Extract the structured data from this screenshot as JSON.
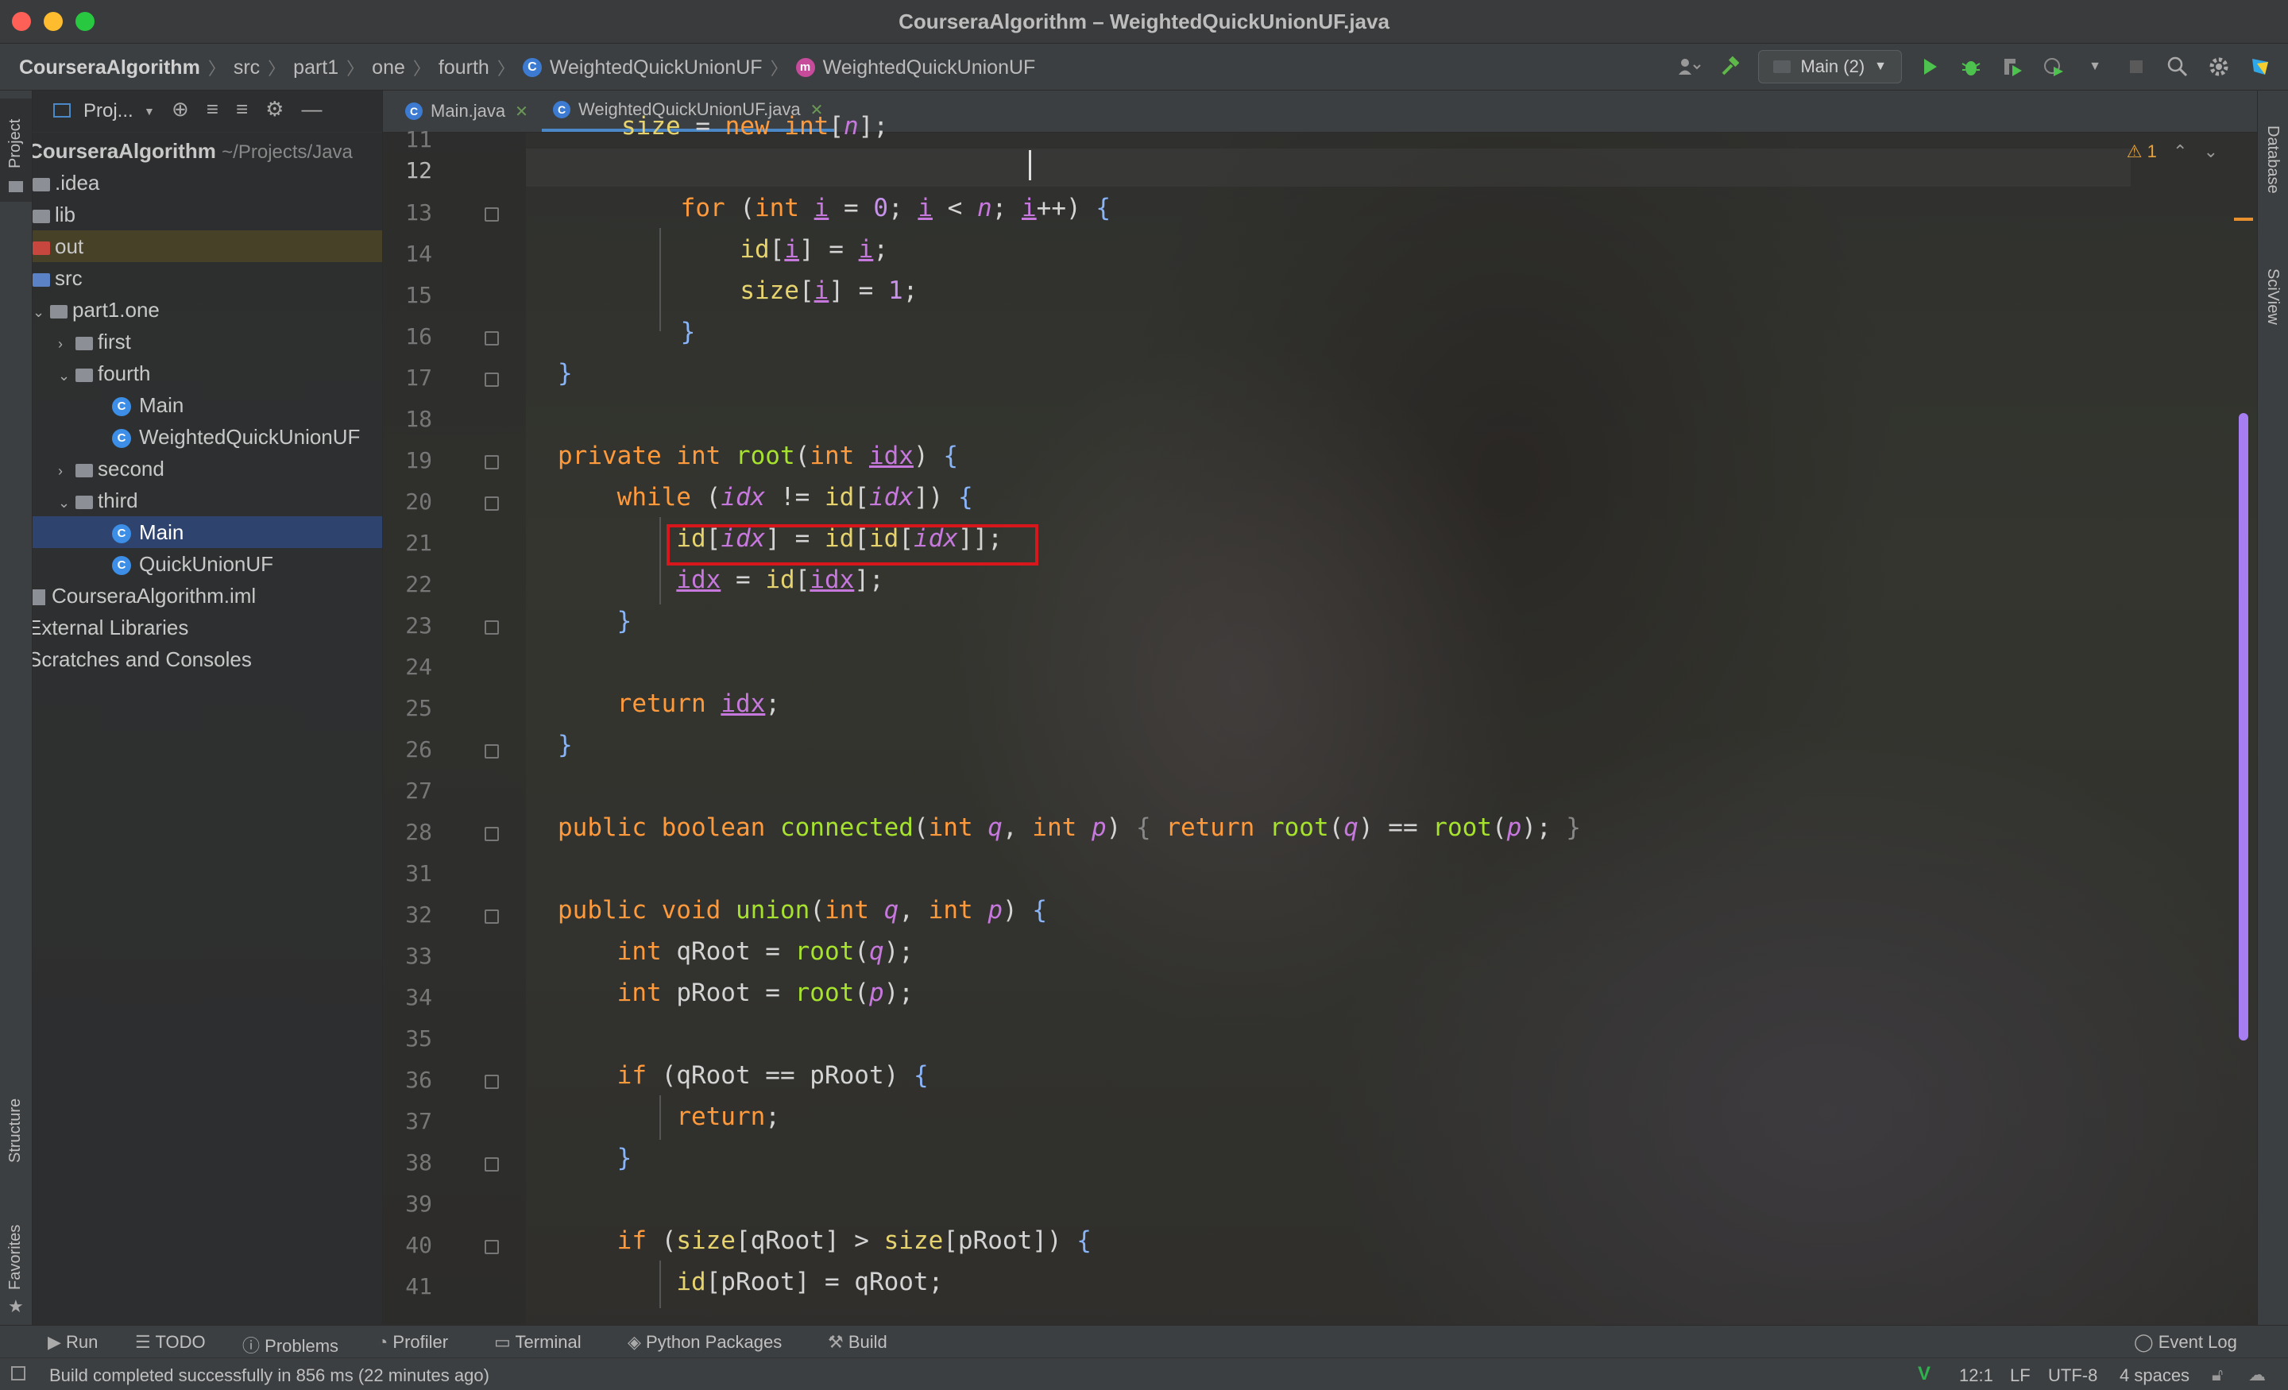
{
  "window": {
    "title": "CourseraAlgorithm – WeightedQuickUnionUF.java"
  },
  "breadcrumbs": [
    "CourseraAlgorithm",
    "src",
    "part1",
    "one",
    "fourth",
    "WeightedQuickUnionUF",
    "WeightedQuickUnionUF"
  ],
  "toolbar": {
    "run_config": "Main (2)"
  },
  "project_panel": {
    "title": "Proj...",
    "tree": [
      {
        "label": "CourseraAlgorithm",
        "extra": "~/Projects/Java",
        "indent": 0,
        "kind": "root"
      },
      {
        "label": ".idea",
        "indent": 0,
        "kind": "folder"
      },
      {
        "label": "lib",
        "indent": 0,
        "kind": "folder"
      },
      {
        "label": "out",
        "indent": 0,
        "kind": "folder-red"
      },
      {
        "label": "src",
        "indent": 0,
        "kind": "folder-blue"
      },
      {
        "label": "part1.one",
        "indent": 1,
        "kind": "package-open"
      },
      {
        "label": "first",
        "indent": 2,
        "kind": "package-closed"
      },
      {
        "label": "fourth",
        "indent": 2,
        "kind": "package-open"
      },
      {
        "label": "Main",
        "indent": 3,
        "kind": "class"
      },
      {
        "label": "WeightedQuickUnionUF",
        "indent": 3,
        "kind": "class"
      },
      {
        "label": "second",
        "indent": 2,
        "kind": "package-closed"
      },
      {
        "label": "third",
        "indent": 2,
        "kind": "package-open"
      },
      {
        "label": "Main",
        "indent": 3,
        "kind": "class",
        "selected": true
      },
      {
        "label": "QuickUnionUF",
        "indent": 3,
        "kind": "class"
      },
      {
        "label": "CourseraAlgorithm.iml",
        "indent": 0,
        "kind": "file"
      },
      {
        "label": "External Libraries",
        "indent": 0,
        "kind": "text"
      },
      {
        "label": "Scratches and Consoles",
        "indent": 0,
        "kind": "text"
      }
    ]
  },
  "tabs": [
    {
      "label": "Main.java",
      "active": false
    },
    {
      "label": "WeightedQuickUnionUF.java",
      "active": true
    }
  ],
  "editor": {
    "line_numbers": [
      "11",
      "12",
      "13",
      "14",
      "15",
      "16",
      "17",
      "18",
      "19",
      "20",
      "21",
      "22",
      "23",
      "24",
      "25",
      "26",
      "27",
      "28",
      "31",
      "32",
      "33",
      "34",
      "35",
      "36",
      "37",
      "38",
      "39",
      "40",
      "41"
    ],
    "current_line": "12",
    "warning_count": "1"
  },
  "left_stripe": {
    "project": "Project",
    "structure": "Structure",
    "favorites": "Favorites"
  },
  "right_stripe": {
    "database": "Database",
    "sciview": "SciView"
  },
  "bottom_tools": [
    "Run",
    "TODO",
    "Problems",
    "Profiler",
    "Terminal",
    "Python Packages",
    "Build"
  ],
  "event_log": "Event Log",
  "status": {
    "message": "Build completed successfully in 856 ms (22 minutes ago)",
    "position": "12:1",
    "line_sep": "LF",
    "encoding": "UTF-8",
    "indent": "4 spaces"
  },
  "colors": {
    "accent_blue": "#4a88c7",
    "highlight_box": "#d8171d",
    "scrollbar": "#a77ef2",
    "keyword": "#ff9a3c",
    "function": "#a6e22e"
  }
}
